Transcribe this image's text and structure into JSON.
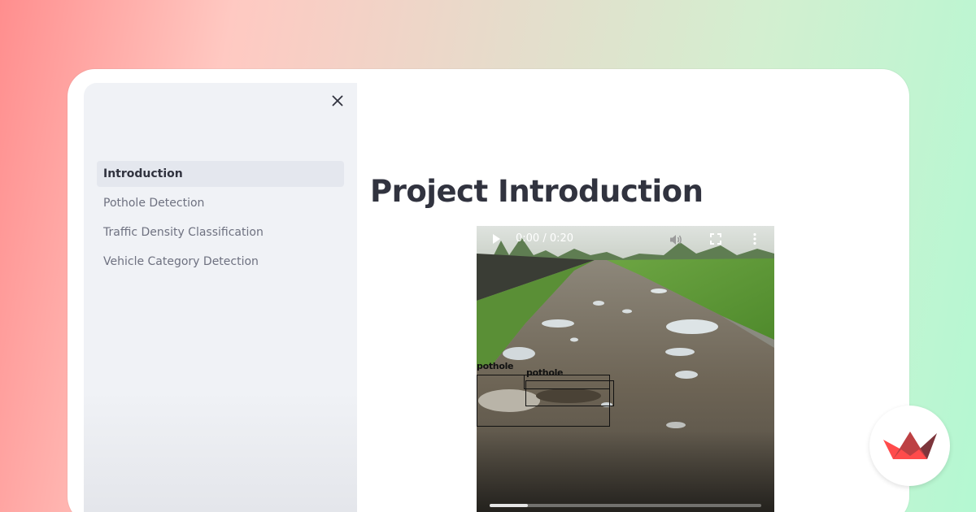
{
  "sidebar": {
    "items": [
      {
        "label": "Introduction",
        "active": true
      },
      {
        "label": "Pothole Detection",
        "active": false
      },
      {
        "label": "Traffic Density Classification",
        "active": false
      },
      {
        "label": "Vehicle Category Detection",
        "active": false
      }
    ],
    "close_icon": "close-icon"
  },
  "main": {
    "title": "Project Introduction"
  },
  "video": {
    "time": "0:00 / 0:20",
    "progress_fraction": 0.14,
    "detections": [
      {
        "label": "pothole"
      },
      {
        "label": "pothole"
      }
    ]
  },
  "colors": {
    "sidebar_bg": "#f0f2f6",
    "active_item_bg": "#e4e7ee",
    "title_text": "#31333f",
    "nav_text": "#6e7180",
    "logo_red": "#e8313b"
  }
}
